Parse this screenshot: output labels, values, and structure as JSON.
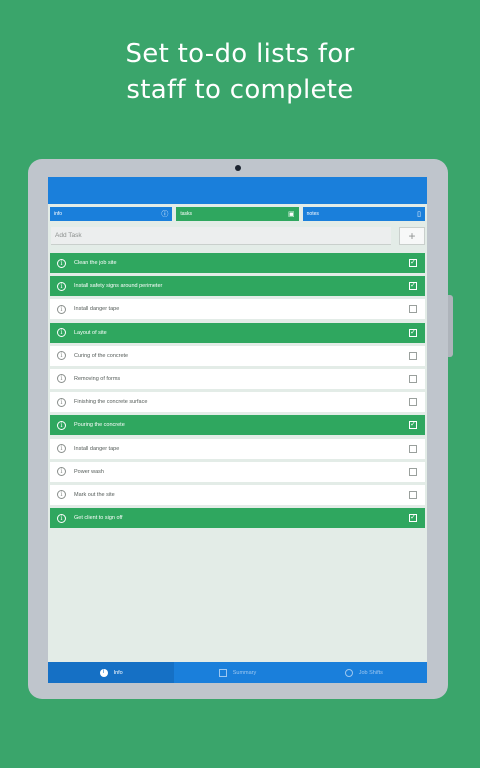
{
  "promo": {
    "line1": "Set to-do lists for",
    "line2": "staff to complete"
  },
  "tabs": [
    {
      "label": "info",
      "icon": "info-icon",
      "color": "#1a7fdb"
    },
    {
      "label": "tasks",
      "icon": "image-icon",
      "color": "#2fa75f"
    },
    {
      "label": "notes",
      "icon": "phone-icon",
      "color": "#1a7fdb"
    }
  ],
  "add_task": {
    "placeholder": "Add Task",
    "button": "+"
  },
  "tasks": [
    {
      "label": "Clean the job site",
      "done": true,
      "check": "✓"
    },
    {
      "label": "Install safety signs around perimeter",
      "done": true,
      "check": "✓"
    },
    {
      "label": "Install danger tape",
      "done": false,
      "check": ""
    },
    {
      "label": "Layout of site",
      "done": true,
      "check": "✓"
    },
    {
      "label": "Curing of the concrete",
      "done": false,
      "check": ""
    },
    {
      "label": "Removing of forms",
      "done": false,
      "check": ""
    },
    {
      "label": "Finishing the concrete surface",
      "done": false,
      "check": ""
    },
    {
      "label": "Pouring the concrete",
      "done": true,
      "check": "✓"
    },
    {
      "label": "Install danger tape",
      "done": false,
      "check": ""
    },
    {
      "label": "Power wash",
      "done": false,
      "check": ""
    },
    {
      "label": "Mark out the site",
      "done": false,
      "check": ""
    },
    {
      "label": "Get client to sign off",
      "done": true,
      "check": "✓"
    }
  ],
  "bottom_nav": [
    {
      "label": "Info",
      "icon": "info-icon",
      "active": true
    },
    {
      "label": "Summary",
      "icon": "chart-icon",
      "active": false
    },
    {
      "label": "Job Shifts",
      "icon": "clock-icon",
      "active": false
    }
  ],
  "colors": {
    "background": "#3aa56b",
    "app_blue": "#1a7fdb",
    "done_green": "#2fa75f"
  }
}
